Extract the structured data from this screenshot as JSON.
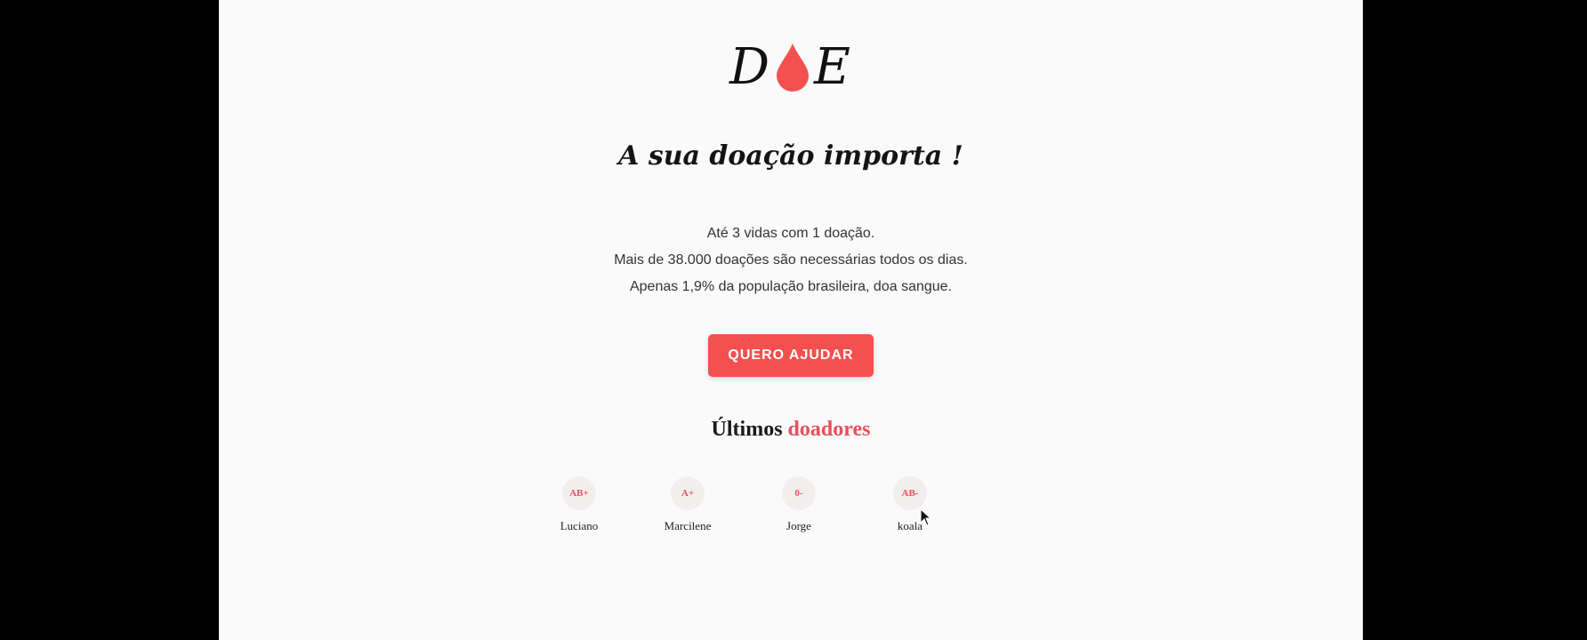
{
  "logo": {
    "left": "D",
    "right": "E",
    "drop_color": "#f4504f"
  },
  "headline": "A sua doação importa !",
  "facts": [
    "Até 3 vidas com 1 doação.",
    "Mais de 38.000 doações são necessárias todos os dias.",
    "Apenas 1,9% da população brasileira, doa sangue."
  ],
  "cta": {
    "label": "QUERO AJUDAR",
    "color": "#f4504f"
  },
  "donors_section": {
    "title_prefix": "Últimos",
    "title_accent": "doadores",
    "accent_color": "#e8505b"
  },
  "donors": [
    {
      "blood_type": "AB+",
      "name": "Luciano"
    },
    {
      "blood_type": "A+",
      "name": "Marcilene"
    },
    {
      "blood_type": "0-",
      "name": "Jorge"
    },
    {
      "blood_type": "AB-",
      "name": "koala"
    }
  ],
  "icons": {
    "logo_drop": "blood-drop-icon",
    "cursor": "mouse-pointer-icon"
  }
}
